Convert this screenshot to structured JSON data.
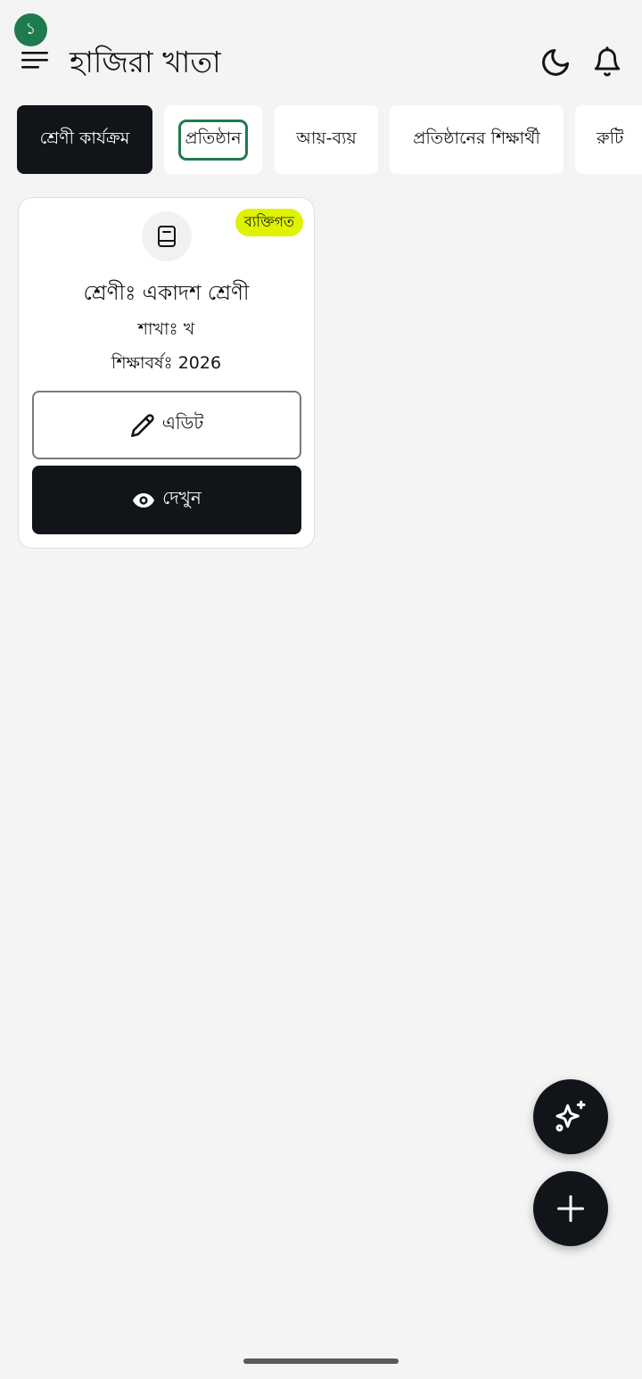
{
  "header": {
    "notification_count": "১",
    "app_title": "হাজিরা খাতা",
    "icons": [
      "menu-icon",
      "moon-icon",
      "bell-icon"
    ]
  },
  "tabs": [
    {
      "label": "শ্রেণী কার্যক্রম",
      "active": true
    },
    {
      "label": "প্রতিষ্ঠান",
      "active": false,
      "focused": true
    },
    {
      "label": "আয়-ব্যয়",
      "active": false
    },
    {
      "label": "প্রতিষ্ঠানের শিক্ষার্থী",
      "active": false
    },
    {
      "label": "রুটি",
      "active": false
    }
  ],
  "class_card": {
    "icon": "book-icon",
    "badge": "ব্যক্তিগত",
    "class_line": "শ্রেণীঃ একাদশ শ্রেণী",
    "section_line": "শাখাঃ খ",
    "year_line": "শিক্ষাবর্ষঃ 2026",
    "edit_label": "এডিট",
    "view_label": "দেখুন"
  },
  "fabs": {
    "ai_icon": "sparkle-icon",
    "add_icon": "plus-icon"
  },
  "colors": {
    "primary_dark": "#111418",
    "accent_green": "#1f7a4d",
    "badge_yellow": "#dff200",
    "background": "#f4f4f4"
  }
}
